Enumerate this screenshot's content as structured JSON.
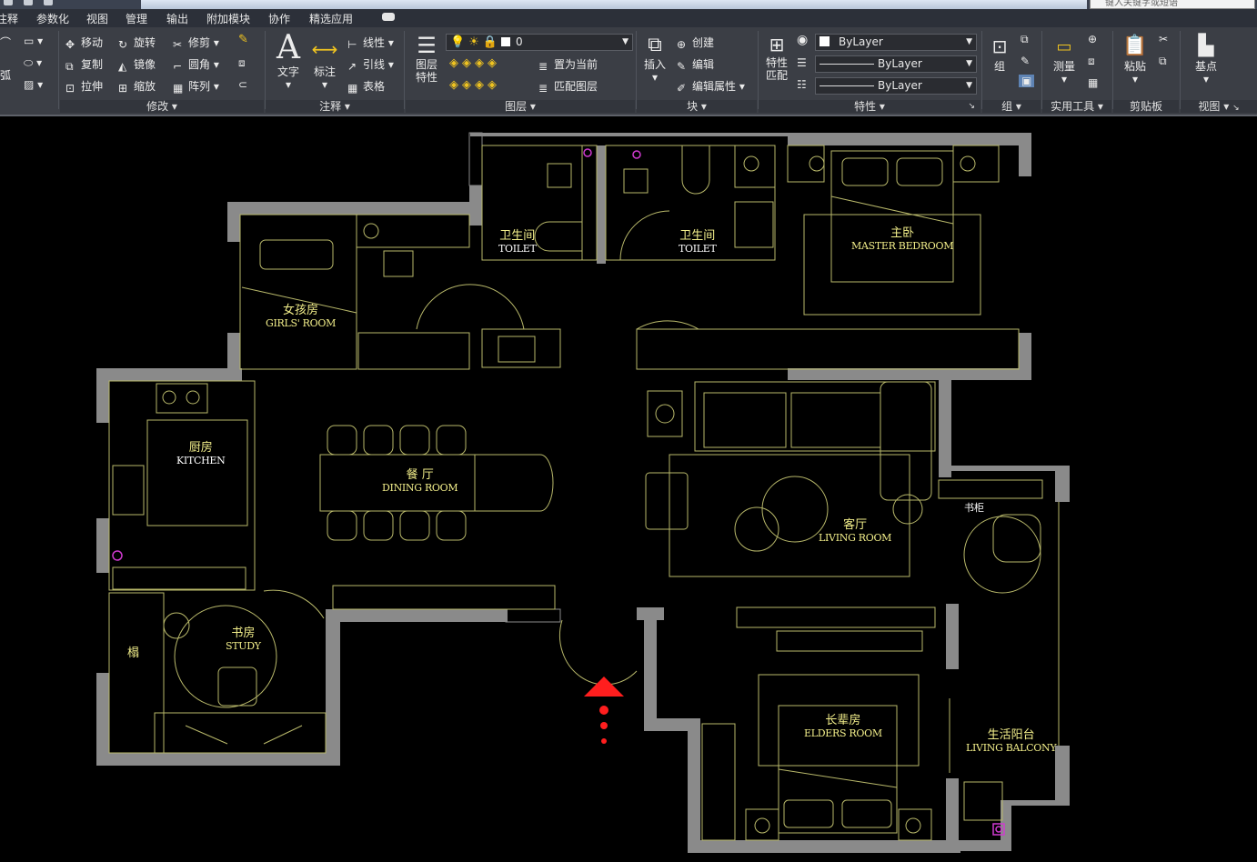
{
  "ribbon_tabs": [
    "注释",
    "参数化",
    "视图",
    "管理",
    "输出",
    "附加模块",
    "协作",
    "精选应用"
  ],
  "search": {
    "placeholder": "键入关键字或短语"
  },
  "ribbon": {
    "draw": {
      "items": [
        "弧"
      ]
    },
    "modify": {
      "items": [
        "移动",
        "旋转",
        "修剪",
        "复制",
        "镜像",
        "圆角",
        "拉伸",
        "缩放",
        "阵列"
      ],
      "label": "修改"
    },
    "annotation": {
      "text": "文字",
      "dim": "标注",
      "items": [
        "线性",
        "引线",
        "表格"
      ],
      "label": "注释"
    },
    "layers": {
      "btn": "图层特性",
      "btn_line1": "图层",
      "btn_line2": "特性",
      "current_layer": "0",
      "items": [
        "置为当前",
        "匹配图层"
      ],
      "label": "图层"
    },
    "block": {
      "insert": "插入",
      "items": [
        "创建",
        "编辑",
        "编辑属性"
      ],
      "label": "块"
    },
    "properties": {
      "match_line1": "特性",
      "match_line2": "匹配",
      "color": "ByLayer",
      "linetype": "ByLayer",
      "lineweight": "ByLayer",
      "label": "特性"
    },
    "groups": {
      "group": "组",
      "label": "组"
    },
    "utilities": {
      "measure": "测量",
      "label": "实用工具"
    },
    "clipboard": {
      "paste": "粘贴",
      "label": "剪贴板"
    },
    "view": {
      "base": "基点",
      "label": "视图"
    }
  },
  "rooms": {
    "toilet1": {
      "cn": "卫生间",
      "en": "TOILET"
    },
    "toilet2": {
      "cn": "卫生间",
      "en": "TOILET"
    },
    "master": {
      "cn": "主卧",
      "en": "MASTER BEDROOM"
    },
    "girls": {
      "cn": "女孩房",
      "en": "GIRLS' ROOM"
    },
    "kitchen": {
      "cn": "厨房",
      "en": "KITCHEN"
    },
    "dining": {
      "cn": "餐 厅",
      "en": "DINING ROOM"
    },
    "living": {
      "cn": "客厅",
      "en": "LIVING ROOM"
    },
    "bookcase": {
      "cn": "书柜"
    },
    "study": {
      "cn": "书房",
      "en": "STUDY"
    },
    "tatami": {
      "cn": "榻"
    },
    "elders": {
      "cn": "长辈房",
      "en": "ELDERS ROOM"
    },
    "balcony": {
      "cn": "生活阳台",
      "en": "LIVING BALCONY"
    }
  },
  "colors": {
    "wall": "#8a8a8a",
    "furniture": "#b8b86a",
    "text": "#f2ee8a",
    "entry_arrow": "#ff1e1e",
    "magenta": "#d03ad0",
    "ribbon_bg": "#3b3e45"
  }
}
